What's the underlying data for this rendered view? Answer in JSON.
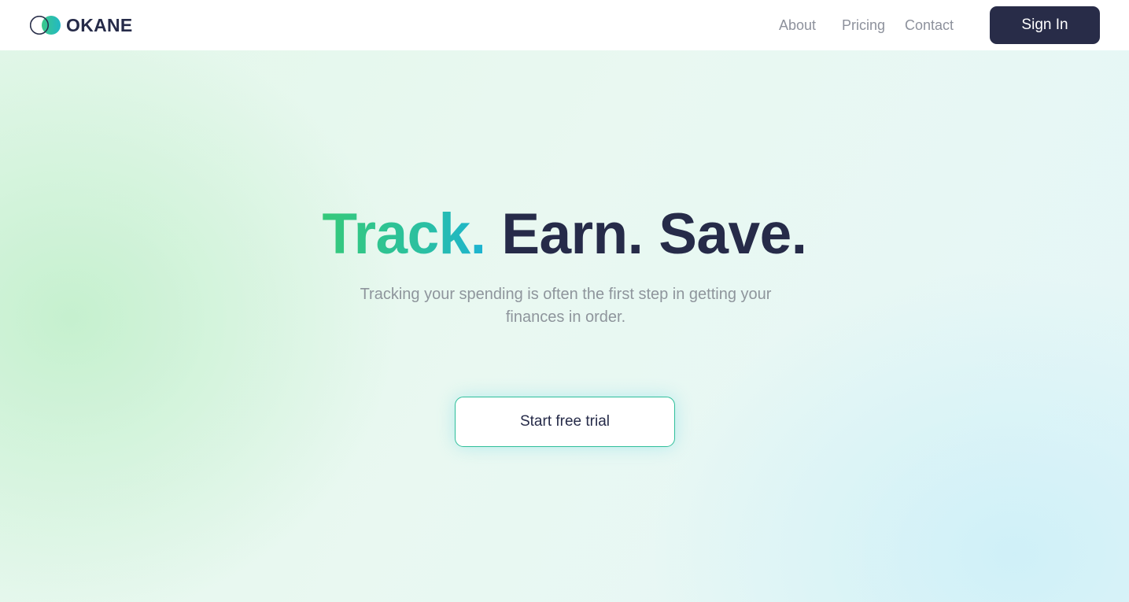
{
  "brand": {
    "name": "OKANE",
    "logo_icon": "overlapping-circles-icon",
    "colors": {
      "primary_dark": "#262b49",
      "accent_green": "#35c97a",
      "accent_teal": "#1cb3d4"
    }
  },
  "nav": {
    "links": [
      {
        "label": "About"
      },
      {
        "label": "Pricing"
      },
      {
        "label": "Contact"
      }
    ],
    "sign_in_label": "Sign In"
  },
  "hero": {
    "headline_accent": "Track.",
    "headline_rest": "Earn. Save.",
    "subtitle": "Tracking your spending is often the first step in getting your finances in order.",
    "cta_label": "Start free trial"
  }
}
